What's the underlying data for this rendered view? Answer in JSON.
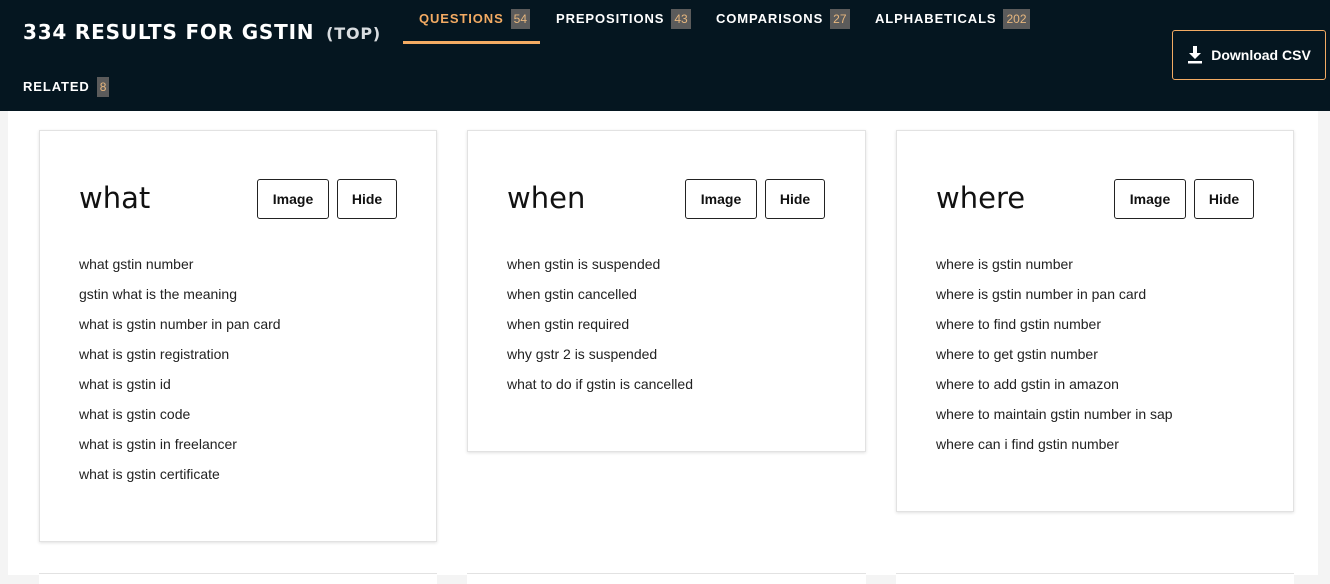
{
  "header": {
    "count": "334",
    "results_label": "RESULTS FOR",
    "keyword": "GSTIN",
    "qualifier": "(TOP)",
    "download_label": "Download CSV"
  },
  "tabs": [
    {
      "label": "QUESTIONS",
      "count": "54",
      "active": true
    },
    {
      "label": "PREPOSITIONS",
      "count": "43",
      "active": false
    },
    {
      "label": "COMPARISONS",
      "count": "27",
      "active": false
    },
    {
      "label": "ALPHABETICALS",
      "count": "202",
      "active": false
    },
    {
      "label": "RELATED",
      "count": "8",
      "active": false
    }
  ],
  "cards": [
    {
      "title": "what",
      "image_label": "Image",
      "hide_label": "Hide",
      "items": [
        "what gstin number",
        "gstin what is the meaning",
        "what is gstin number in pan card",
        "what is gstin registration",
        "what is gstin id",
        "what is gstin code",
        "what is gstin in freelancer",
        "what is gstin certificate"
      ]
    },
    {
      "title": "when",
      "image_label": "Image",
      "hide_label": "Hide",
      "items": [
        "when gstin is suspended",
        "when gstin cancelled",
        "when gstin required",
        "why gstr 2 is suspended",
        "what to do if gstin is cancelled"
      ]
    },
    {
      "title": "where",
      "image_label": "Image",
      "hide_label": "Hide",
      "items": [
        "where is gstin number",
        "where is gstin number in pan card",
        "where to find gstin number",
        "where to get gstin number",
        "where to add gstin in amazon",
        "where to maintain gstin number in sap",
        "where can i find gstin number"
      ]
    }
  ],
  "colors": {
    "header_bg": "#051620",
    "accent": "#f3ab63",
    "badge_bg": "#5b5b5b"
  }
}
